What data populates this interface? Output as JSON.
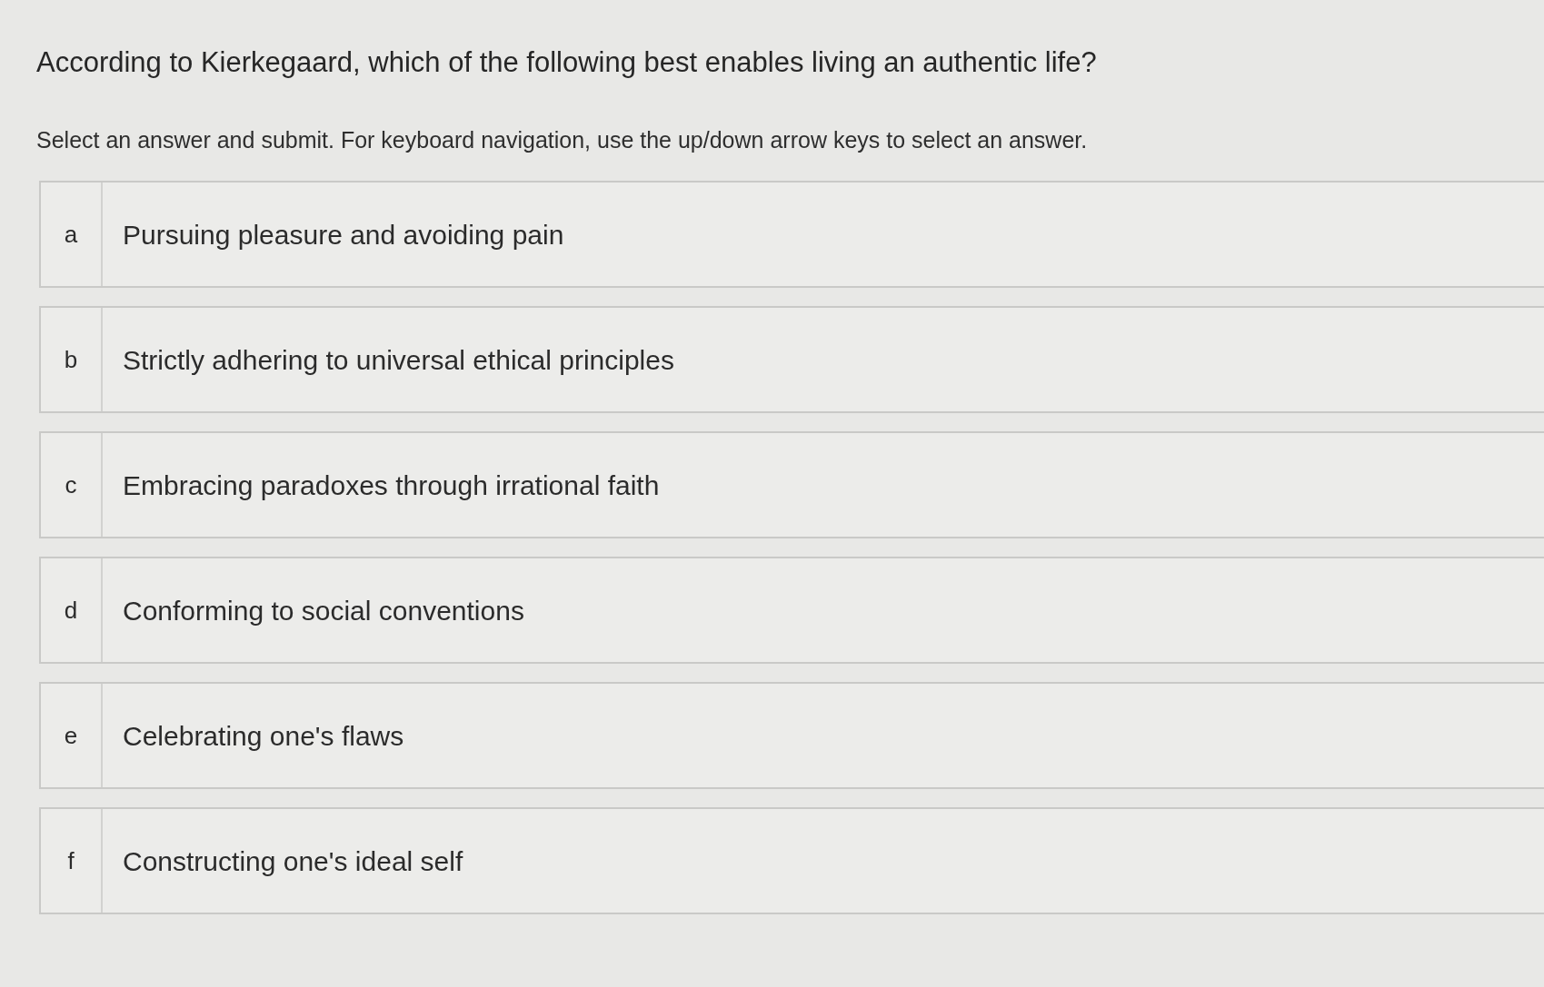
{
  "question": "According to Kierkegaard, which of the following best enables living an authentic life?",
  "instructions": "Select an answer and submit. For keyboard navigation, use the up/down arrow keys to select an answer.",
  "options": [
    {
      "letter": "a",
      "text": "Pursuing pleasure and avoiding pain",
      "selected": false
    },
    {
      "letter": "b",
      "text": "Strictly adhering to universal ethical principles",
      "selected": false
    },
    {
      "letter": "c",
      "text": "Embracing paradoxes through irrational faith",
      "selected": false
    },
    {
      "letter": "d",
      "text": "Conforming to social conventions",
      "selected": false
    },
    {
      "letter": "e",
      "text": "Celebrating one's flaws",
      "selected": false
    },
    {
      "letter": "f",
      "text": "Constructing one's ideal self",
      "selected": false
    }
  ]
}
